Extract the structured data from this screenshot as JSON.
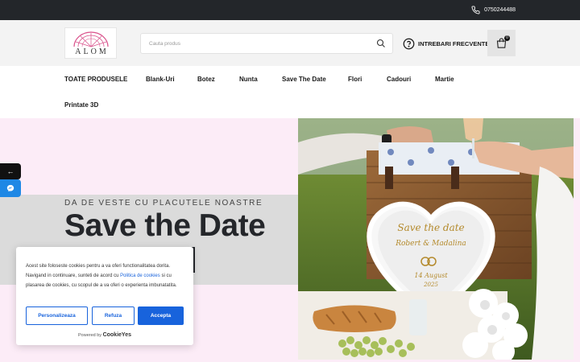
{
  "topbar": {
    "phone": "0750244488"
  },
  "header": {
    "logo_text": "ALOM",
    "search_placeholder": "Cauta produs",
    "faq_label": "INTREBARI FRECVENTE",
    "cart_count": "0"
  },
  "nav": {
    "items": [
      "TOATE PRODUSELE",
      "Blank-Uri",
      "Botez",
      "Nunta",
      "Save The Date",
      "Flori",
      "Cadouri",
      "Martie",
      "Printate 3D"
    ]
  },
  "hero": {
    "eyebrow": "DA DE VESTE CU PLACUTELE NOASTRE",
    "headline": "Save the Date",
    "photo_sign_line1": "Save the date",
    "photo_sign_line2": "Robert & Madalina",
    "photo_sign_line3": "14 August",
    "photo_sign_line4": "2025"
  },
  "cookie": {
    "text_part1": "Acest site foloseste cookies pentru a va oferi functionalitatea dorita. Navigand in continuare, sunteti de acord cu ",
    "policy_link": "Politica de cookies",
    "text_part2": " si cu plasarea de cookies, cu scopul de a va oferi o experienta imbunatatita.",
    "customize_label": "Personalizeaza",
    "reject_label": "Refuza",
    "accept_label": "Accepta",
    "powered_by": "Powered by",
    "brand": "CookieYes"
  },
  "colors": {
    "topbar": "#23262a",
    "accent_blue": "#1863dc",
    "hero_bg": "#fcecf7",
    "messenger": "#1e88e5"
  },
  "icons": {
    "phone": "phone-icon",
    "search": "search-icon",
    "faq": "question-circle-icon",
    "cart": "shopping-bag-icon",
    "back": "arrow-left-icon",
    "messenger": "messenger-icon"
  }
}
